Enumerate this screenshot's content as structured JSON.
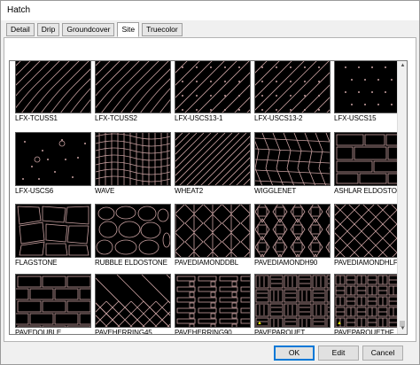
{
  "window": {
    "title": "Hatch"
  },
  "tabs": [
    {
      "label": "Detail"
    },
    {
      "label": "Drip"
    },
    {
      "label": "Groundcover"
    },
    {
      "label": "Site",
      "active": true
    },
    {
      "label": "Truecolor"
    }
  ],
  "patterns": [
    {
      "label": "LFX-TCUSS1",
      "icon": "wavy-lines-pattern"
    },
    {
      "label": "LFX-TCUSS2",
      "icon": "wavy-lines-pattern"
    },
    {
      "label": "LFX-USCS13-1",
      "icon": "diagonal-dots-pattern"
    },
    {
      "label": "LFX-USCS13-2",
      "icon": "diagonal-dots-pattern"
    },
    {
      "label": "LFX-USCS15",
      "icon": "dots-pattern"
    },
    {
      "label": "LFX-USCS6",
      "icon": "scattered-dots-pattern"
    },
    {
      "label": "WAVE",
      "icon": "wave-pattern"
    },
    {
      "label": "WHEAT2",
      "icon": "diagonal-lines-pattern"
    },
    {
      "label": "WIGGLENET",
      "icon": "wiggle-net-pattern"
    },
    {
      "label": "ASHLAR ELDOSTONE",
      "icon": "ashlar-pattern"
    },
    {
      "label": "FLAGSTONE",
      "icon": "flagstone-pattern"
    },
    {
      "label": "RUBBLE ELDOSTONE",
      "icon": "rubble-pattern"
    },
    {
      "label": "PAVEDIAMONDDBL",
      "icon": "diamond-pattern"
    },
    {
      "label": "PAVEDIAMONDH90",
      "icon": "diamond-grid-pattern"
    },
    {
      "label": "PAVEDIAMONDHLF",
      "icon": "diamond-half-pattern"
    },
    {
      "label": "PAVEDOUBLE",
      "icon": "brick-pattern"
    },
    {
      "label": "PAVEHERRING45",
      "icon": "herringbone-45-pattern"
    },
    {
      "label": "PAVEHERRING90",
      "icon": "herringbone-90-pattern"
    },
    {
      "label": "PAVEPARQUET",
      "icon": "parquet-pattern"
    },
    {
      "label": "PAVEPARQUETHF",
      "icon": "parquet-half-pattern"
    }
  ],
  "buttons": {
    "ok": "OK",
    "edit": "Edit",
    "cancel": "Cancel"
  },
  "colors": {
    "pattern_bg": "#000000",
    "pattern_line": "#c8a0a0",
    "accent": "#0078d7"
  }
}
